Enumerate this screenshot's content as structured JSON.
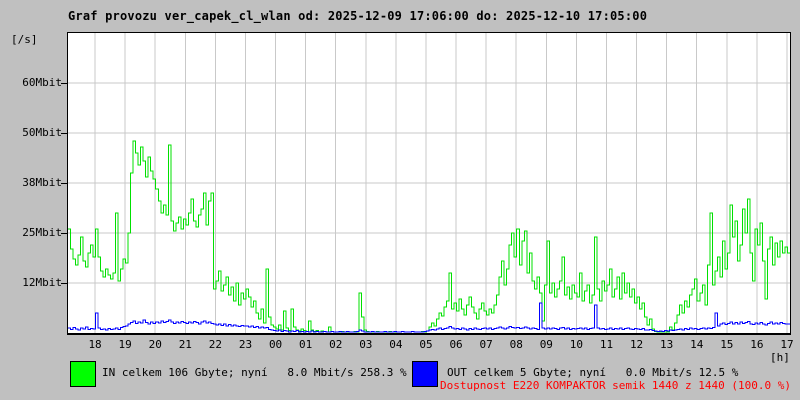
{
  "title": "Graf provozu ver_capek_cl_wlan od: 2025-12-09 17:06:00 do: 2025-12-10 17:05:00",
  "y_axis": {
    "unit": "[/s]",
    "tick_labels": [
      "60Mbit",
      "50Mbit",
      "38Mbit",
      "25Mbit",
      "12Mbit"
    ]
  },
  "x_axis": {
    "unit": "[h]",
    "tick_labels": [
      "18",
      "19",
      "20",
      "21",
      "22",
      "23",
      "00",
      "01",
      "02",
      "03",
      "04",
      "05",
      "06",
      "07",
      "08",
      "09",
      "10",
      "11",
      "12",
      "13",
      "14",
      "15",
      "16",
      "17"
    ]
  },
  "legend": {
    "in_label": "IN celkem 106 Gbyte; nyní   8.0 Mbit/s 258.3 %",
    "out_label": "OUT celkem 5 Gbyte; nyní   0.0 Mbit/s 12.5 %",
    "availability": "Dostupnost E220 KOMPAKTOR semik 1440 z 1440 (100.0 %)"
  },
  "colors": {
    "background": "#c0c0c0",
    "plot_background": "#ffffff",
    "grid": "#c9c9c9",
    "in_line": "#00e000",
    "in_swatch": "#00ff00",
    "out_line": "#0000ff",
    "out_swatch": "#0000ff",
    "availability_text": "#ff0000"
  },
  "chart_data": {
    "type": "line",
    "title": "Graf provozu ver_capek_cl_wlan od: 2025-12-09 17:06:00 do: 2025-12-10 17:05:00",
    "xlabel": "[h]",
    "ylabel": "[/s]",
    "x_start": "2025-12-09 17:06:00",
    "x_end": "2025-12-10 17:05:00",
    "sample_interval_min": 5,
    "hours_span": 24,
    "first_hour_gridline": 18,
    "ylim": [
      0,
      75
    ],
    "y_gridline_values": [
      62.5,
      50,
      37.5,
      25,
      12.5
    ],
    "grid": true,
    "legend_position": "bottom",
    "series": [
      {
        "name": "IN",
        "unit": "Mbit/s",
        "color": "#00e000",
        "values": [
          26,
          21,
          18.5,
          17,
          19.5,
          24,
          18,
          16.5,
          20,
          22,
          19,
          26,
          19,
          15.5,
          14,
          16,
          14.5,
          13.5,
          15,
          30,
          13,
          16,
          18.5,
          17.5,
          25,
          40,
          48,
          45,
          42,
          46.5,
          43,
          39,
          44,
          40.5,
          38.5,
          36,
          33,
          30,
          32,
          29.5,
          47,
          28,
          25.5,
          27.5,
          29,
          26,
          28.5,
          27,
          30,
          33.5,
          28,
          26.5,
          29.5,
          31,
          35,
          27,
          33,
          35,
          11,
          13,
          15.5,
          10.5,
          12,
          14,
          9.5,
          11.5,
          8,
          12.5,
          7,
          10,
          8.5,
          11,
          9,
          6.5,
          8,
          5,
          3.5,
          6,
          2.5,
          16,
          4,
          2,
          1.5,
          1,
          2,
          0.8,
          5.5,
          1.2,
          0.6,
          6,
          1.5,
          0.8,
          0.5,
          1,
          0.6,
          0.4,
          3,
          0.8,
          0.4,
          0.6,
          0.3,
          0.5,
          0.4,
          0.3,
          1.5,
          0.4,
          0.3,
          0.3,
          0.2,
          0.4,
          0.3,
          0.2,
          0.3,
          0.2,
          0.4,
          0.3,
          10,
          4,
          0.8,
          0.4,
          0.3,
          0.2,
          0.3,
          0.4,
          0.2,
          0.3,
          0.2,
          0.3,
          0.4,
          0.3,
          0.2,
          0.3,
          0.2,
          0.4,
          0.3,
          0.2,
          0.3,
          0.4,
          0.2,
          0.3,
          0.2,
          0.4,
          0.3,
          0.5,
          1.5,
          2.5,
          1.8,
          3.5,
          5,
          4.2,
          6.5,
          8,
          15,
          6,
          7.5,
          5.5,
          8.5,
          6,
          4.5,
          7,
          9,
          6.5,
          5,
          3.5,
          6,
          7.5,
          5.5,
          4.5,
          6,
          5,
          7,
          9.5,
          14,
          18,
          12,
          16,
          22,
          25,
          19,
          26,
          17,
          23,
          25.5,
          15,
          20,
          13,
          11,
          14,
          10,
          3,
          12,
          23,
          10,
          12.5,
          9,
          11,
          13,
          19,
          9.5,
          11.5,
          8.5,
          12,
          10,
          9,
          15,
          8,
          10.5,
          12,
          7.5,
          9.5,
          24,
          11,
          8,
          13,
          10.5,
          12,
          16,
          9,
          11,
          14,
          8.5,
          15,
          10,
          12.5,
          9,
          11,
          7.5,
          9,
          6,
          7.5,
          4,
          2,
          3.5,
          1,
          0.4,
          0.2,
          0.3,
          0.2,
          0.3,
          0.2,
          1.5,
          0.8,
          2.5,
          4.5,
          7,
          5,
          8,
          6.5,
          9.5,
          11,
          13.5,
          8,
          10,
          12,
          7,
          17,
          30,
          12,
          15.5,
          19,
          14,
          23,
          16,
          20,
          32,
          24,
          28,
          18,
          22,
          31,
          25,
          33.5,
          20,
          13,
          26,
          22,
          27.5,
          18,
          8.5,
          21,
          24,
          17,
          22.5,
          19,
          23,
          20,
          21.5,
          20
        ]
      },
      {
        "name": "OUT",
        "unit": "Mbit/s",
        "color": "#0000ff",
        "values": [
          1.2,
          0.9,
          1.4,
          1,
          0.8,
          1.3,
          1,
          1.5,
          0.9,
          1.1,
          1,
          5,
          1.2,
          0.9,
          1,
          0.8,
          1.1,
          0.9,
          1,
          1.2,
          0.9,
          1.4,
          1.6,
          1.8,
          2.2,
          2.6,
          3,
          2.4,
          2.8,
          2.5,
          3.2,
          2.6,
          2.3,
          2.7,
          2.4,
          2.8,
          2.5,
          3,
          2.6,
          2.9,
          3.3,
          2.7,
          2.4,
          2.8,
          2.5,
          2.9,
          2.6,
          2.4,
          2.8,
          2.5,
          2.9,
          2.6,
          2.3,
          2.7,
          3,
          2.5,
          2.8,
          2.4,
          2.2,
          2,
          2.3,
          1.9,
          2.2,
          1.8,
          2.1,
          1.7,
          2,
          1.8,
          1.6,
          1.9,
          1.7,
          1.8,
          1.5,
          1.7,
          1.4,
          1.6,
          1.3,
          1.5,
          1.2,
          1.4,
          0.9,
          0.7,
          0.6,
          0.5,
          0.7,
          0.4,
          0.6,
          0.5,
          0.3,
          0.5,
          0.4,
          0.6,
          0.3,
          0.4,
          0.3,
          0.4,
          0.3,
          0.5,
          0.3,
          0.4,
          0.2,
          0.3,
          0.4,
          0.3,
          0.2,
          0.4,
          0.3,
          0.3,
          0.4,
          0.2,
          0.3,
          0.4,
          0.3,
          0.2,
          0.3,
          0.4,
          0.8,
          0.5,
          0.3,
          0.3,
          0.2,
          0.4,
          0.3,
          0.2,
          0.3,
          0.2,
          0.4,
          0.3,
          0.2,
          0.3,
          0.4,
          0.2,
          0.3,
          0.4,
          0.2,
          0.3,
          0.2,
          0.4,
          0.3,
          0.2,
          0.3,
          0.2,
          0.4,
          0.5,
          0.7,
          0.9,
          0.8,
          1,
          1.2,
          0.9,
          1.1,
          1.3,
          1.6,
          1.2,
          1,
          1.1,
          0.9,
          1.2,
          1,
          0.8,
          1.1,
          0.9,
          1.2,
          1,
          0.9,
          1.1,
          1.3,
          1,
          1.2,
          0.9,
          1.1,
          1.3,
          1.5,
          1.2,
          1,
          1.3,
          1.6,
          1.4,
          1.2,
          1.4,
          1.1,
          1.3,
          1.5,
          1.2,
          1,
          1.3,
          1.1,
          0.9,
          7.5,
          1.2,
          1,
          1.2,
          1,
          1.3,
          1.1,
          0.9,
          1.2,
          1.4,
          1,
          1.2,
          0.9,
          1.1,
          1,
          1.1,
          1.3,
          1,
          1.2,
          0.9,
          1.1,
          1.3,
          7,
          1.2,
          1,
          1.1,
          0.9,
          1,
          1.2,
          0.9,
          1.1,
          1,
          1.2,
          0.9,
          1.1,
          1.3,
          1,
          0.9,
          1.1,
          1,
          0.9,
          1.1,
          0.8,
          0.7,
          0.9,
          0.6,
          0.5,
          0.4,
          0.5,
          0.4,
          0.6,
          0.5,
          0.7,
          0.6,
          0.8,
          0.9,
          1,
          0.8,
          1.1,
          0.9,
          1.2,
          1,
          1.1,
          0.9,
          1.1,
          1.2,
          1,
          1.3,
          1.1,
          1.4,
          5,
          1.8,
          2.2,
          2.5,
          2.1,
          2.4,
          2.7,
          2.2,
          2.6,
          2.3,
          2.8,
          2.4,
          2.6,
          2.9,
          2.3,
          2.1,
          2.5,
          2.3,
          2.6,
          2.2,
          2,
          2.4,
          2.7,
          2.3,
          2.5,
          2.2,
          2.6,
          2.4,
          2.2,
          2.3
        ]
      }
    ]
  }
}
